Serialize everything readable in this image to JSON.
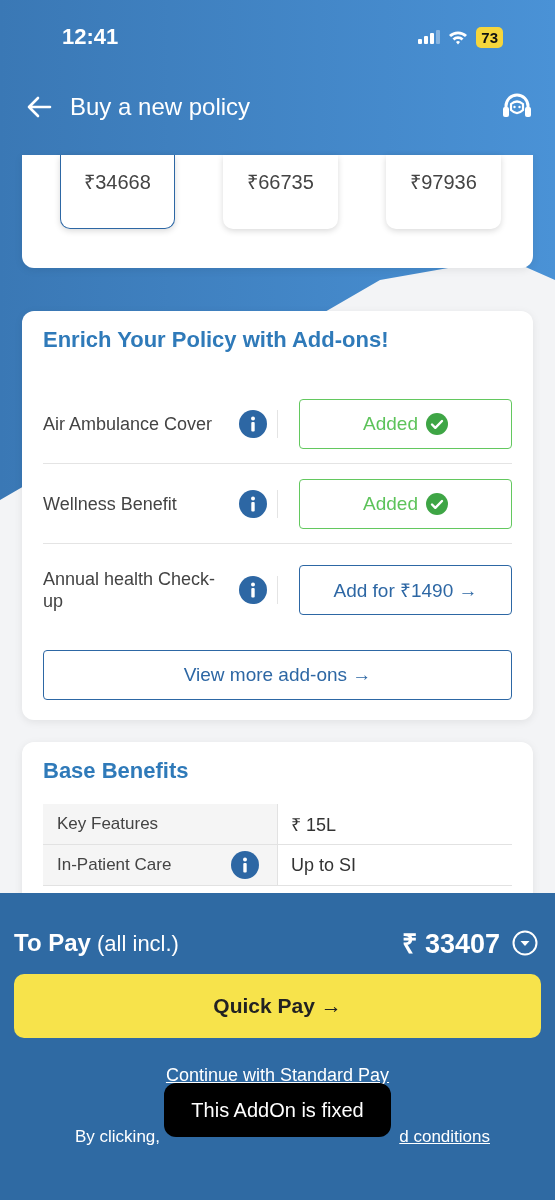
{
  "status_bar": {
    "time": "12:41",
    "battery": "73"
  },
  "header": {
    "title": "Buy a new policy"
  },
  "premium_options": [
    {
      "amount": "₹34668",
      "selected": true
    },
    {
      "amount": "₹66735",
      "selected": false
    },
    {
      "amount": "₹97936",
      "selected": false
    }
  ],
  "addons": {
    "title": "Enrich Your Policy with Add-ons!",
    "items": [
      {
        "name": "Air Ambulance Cover",
        "added": true,
        "button": "Added"
      },
      {
        "name": "Wellness Benefit",
        "added": true,
        "button": "Added"
      },
      {
        "name": "Annual health Check-up",
        "added": false,
        "button": "Add for ₹1490 →"
      }
    ],
    "more_button": "View more add-ons →"
  },
  "base_benefits": {
    "title": "Base Benefits",
    "rows": [
      {
        "feature": "Key Features",
        "info": false,
        "value": "₹ 15L"
      },
      {
        "feature": "In-Patient Care",
        "info": true,
        "value": "Up to SI"
      }
    ]
  },
  "payment": {
    "label": "To Pay",
    "note": "(all incl.)",
    "amount": "₹ 33407",
    "quick_pay": "Quick Pay →",
    "standard_pay": "Continue with Standard Pay",
    "legal": "By clicking,",
    "legal_link": "d conditions"
  },
  "toast": "This AddOn is fixed"
}
